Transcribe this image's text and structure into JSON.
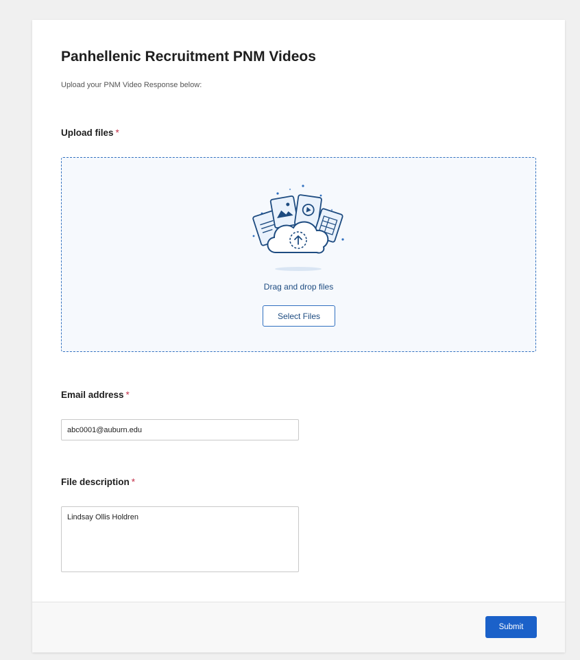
{
  "form": {
    "title": "Panhellenic Recruitment PNM Videos",
    "subtitle": "Upload your PNM Video Response below:"
  },
  "upload": {
    "label": "Upload files",
    "required_mark": "*",
    "illustration_icon": "cloud-upload-files-icon",
    "drag_text": "Drag and drop files",
    "select_button": "Select Files"
  },
  "email": {
    "label": "Email address",
    "required_mark": "*",
    "value": "abc0001@auburn.edu"
  },
  "description": {
    "label": "File description",
    "required_mark": "*",
    "value": "Lindsay Ollis Holdren"
  },
  "footer": {
    "submit_label": "Submit"
  },
  "colors": {
    "accent": "#1b61c9",
    "dropzone_border": "#2f6fbf",
    "required": "#c4314b"
  }
}
